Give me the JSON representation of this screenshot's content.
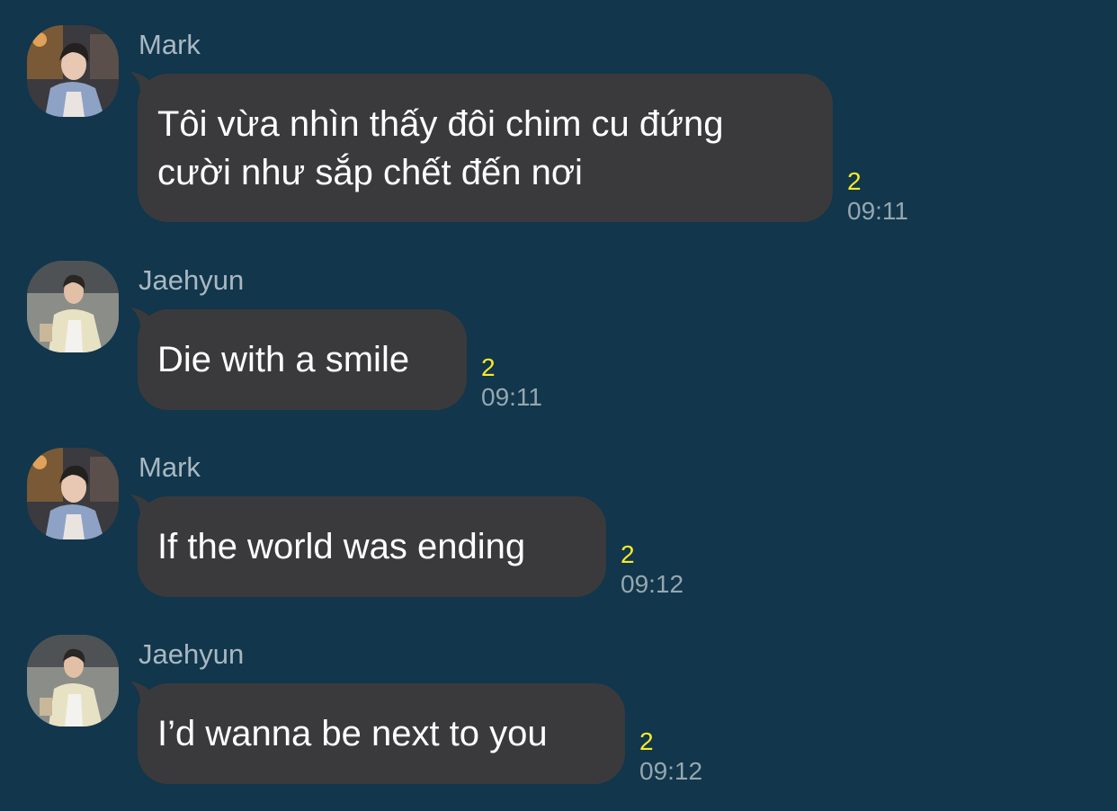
{
  "colors": {
    "background": "#12364b",
    "bubble": "#3a3a3c",
    "sender_name": "#a8b8c2",
    "unread_count": "#f5ea2a",
    "timestamp": "#96a6b0"
  },
  "messages": [
    {
      "sender": "Mark",
      "avatar_icon": "mark-profile-photo",
      "text": "Tôi vừa nhìn thấy đôi chim cu đứng\ncười như sắp chết đến nơi",
      "unread": "2",
      "time": "09:11"
    },
    {
      "sender": "Jaehyun",
      "avatar_icon": "jaehyun-profile-photo",
      "text": "Die with a smile",
      "unread": "2",
      "time": "09:11"
    },
    {
      "sender": "Mark",
      "avatar_icon": "mark-profile-photo",
      "text": "If the world was ending",
      "unread": "2",
      "time": "09:12"
    },
    {
      "sender": "Jaehyun",
      "avatar_icon": "jaehyun-profile-photo",
      "text": "I’d wanna be next to you",
      "unread": "2",
      "time": "09:12"
    }
  ]
}
